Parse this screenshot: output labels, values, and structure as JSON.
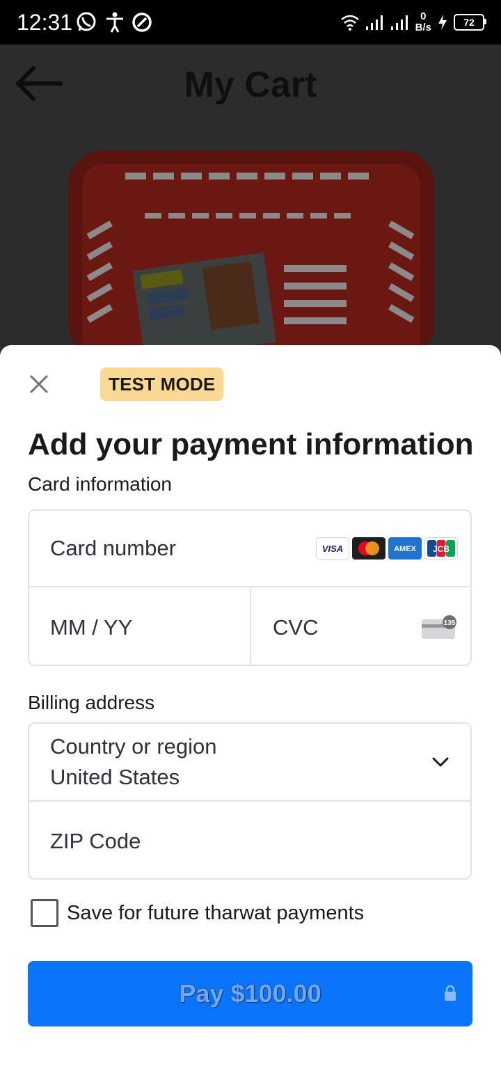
{
  "status_bar": {
    "time": "12:31",
    "net_speed_value": "0",
    "net_speed_unit": "B/s",
    "battery": "72",
    "icons": [
      "whatsapp-icon",
      "accessibility-icon",
      "at-sign-icon",
      "wifi-icon",
      "signal-icon",
      "signal-icon",
      "charging-icon",
      "battery-icon"
    ]
  },
  "app": {
    "title": "My Cart",
    "back_icon": "arrow-left-icon"
  },
  "sheet": {
    "badge": "TEST MODE",
    "title": "Add your payment information",
    "card_section_label": "Card information",
    "card_number_placeholder": "Card number",
    "expiry_placeholder": "MM / YY",
    "cvc_placeholder": "CVC",
    "cvc_badge": "135",
    "card_brands": [
      "VISA",
      "mastercard",
      "AMEX",
      "JCB"
    ],
    "billing_section_label": "Billing address",
    "country_label": "Country or region",
    "country_value": "United States",
    "zip_placeholder": "ZIP Code",
    "save_label": "Save for future tharwat payments",
    "save_checked": false,
    "pay_label": "Pay $100.00",
    "colors": {
      "pay_button": "#0a74fb",
      "badge": "#fbd992"
    }
  }
}
